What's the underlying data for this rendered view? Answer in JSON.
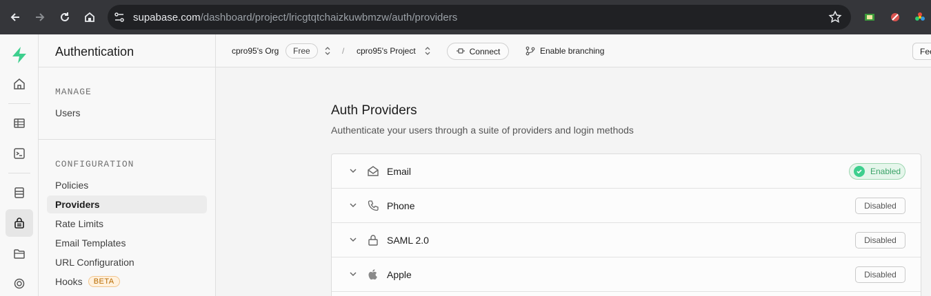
{
  "browser": {
    "url_domain": "supabase.com",
    "url_path": "/dashboard/project/lricgtqtchaizkuwbmzw/auth/providers"
  },
  "sidebar": {
    "title": "Authentication",
    "manage_label": "MANAGE",
    "manage_items": [
      {
        "label": "Users"
      }
    ],
    "config_label": "CONFIGURATION",
    "config_items": [
      {
        "label": "Policies"
      },
      {
        "label": "Providers",
        "active": true
      },
      {
        "label": "Rate Limits"
      },
      {
        "label": "Email Templates"
      },
      {
        "label": "URL Configuration"
      },
      {
        "label": "Hooks",
        "badge": "BETA"
      }
    ]
  },
  "topbar": {
    "org": "cpro95's Org",
    "plan_badge": "Free",
    "separator": "/",
    "project": "cpro95's Project",
    "connect_label": "Connect",
    "branching_label": "Enable branching",
    "feedback_label": "Fee"
  },
  "main": {
    "title": "Auth Providers",
    "subtitle": "Authenticate your users through a suite of providers and login methods",
    "providers": [
      {
        "name": "Email",
        "status": "Enabled",
        "icon": "envelope-icon"
      },
      {
        "name": "Phone",
        "status": "Disabled",
        "icon": "phone-icon"
      },
      {
        "name": "SAML 2.0",
        "status": "Disabled",
        "icon": "lock-icon"
      },
      {
        "name": "Apple",
        "status": "Disabled",
        "icon": "apple-icon"
      }
    ]
  },
  "colors": {
    "brand": "#3ecf8e",
    "browser_bar": "#35363a",
    "enabled_text": "#3ba368"
  }
}
